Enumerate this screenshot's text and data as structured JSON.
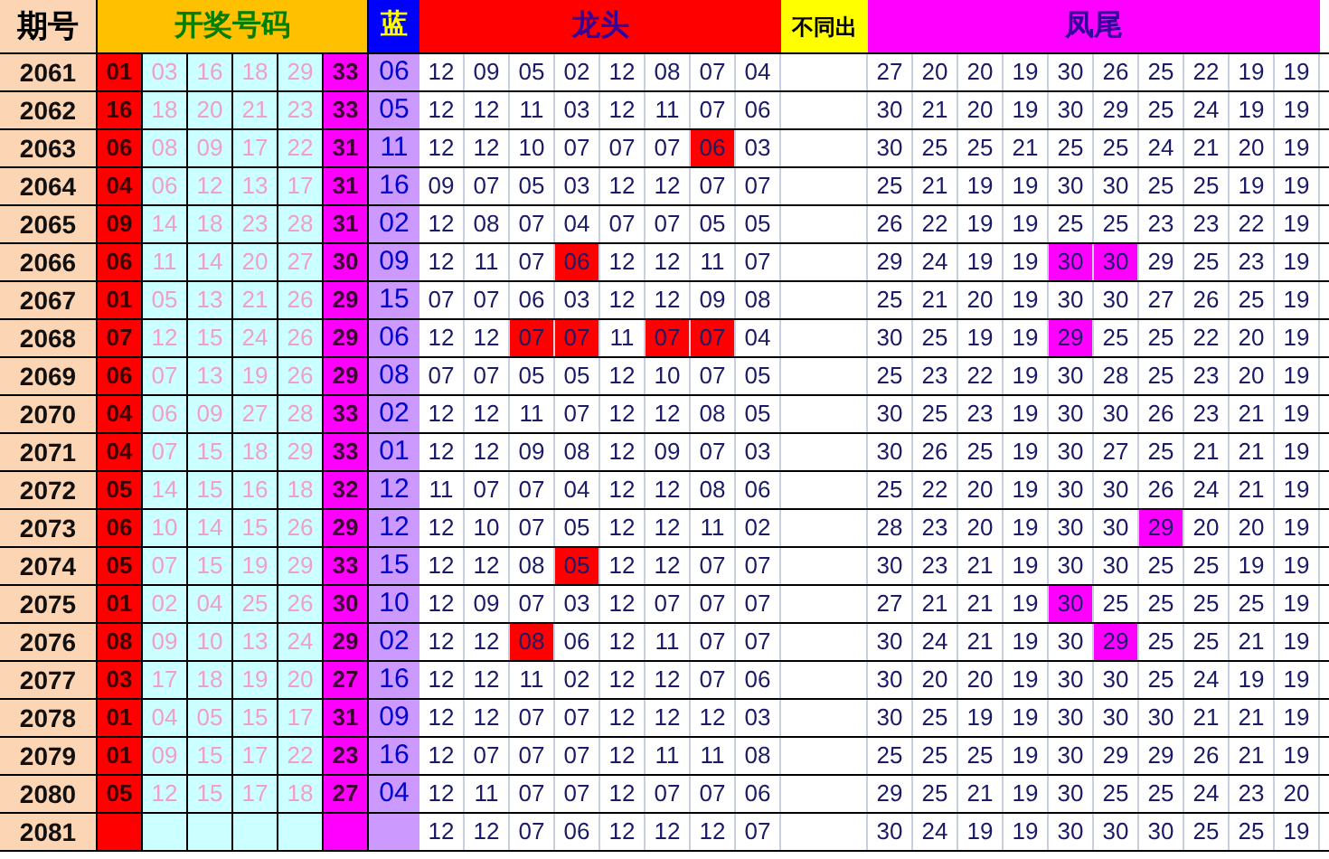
{
  "headers": {
    "period": "期号",
    "draw": "开奖号码",
    "blue": "蓝",
    "dragon": "龙头",
    "distinct": "不同出",
    "phoenix": "凤尾"
  },
  "rows": [
    {
      "period": "2061",
      "balls": [
        "01",
        "03",
        "16",
        "18",
        "29",
        "33"
      ],
      "blue": "06",
      "dragon": [
        {
          "n": "12",
          "hit": false
        },
        {
          "n": "09",
          "hit": false
        },
        {
          "n": "05",
          "hit": false
        },
        {
          "n": "02",
          "hit": false
        },
        {
          "n": "12",
          "hit": false
        },
        {
          "n": "08",
          "hit": false
        },
        {
          "n": "07",
          "hit": false
        },
        {
          "n": "04",
          "hit": false
        }
      ],
      "phoenix": [
        {
          "n": "27",
          "hit": false
        },
        {
          "n": "20",
          "hit": false
        },
        {
          "n": "20",
          "hit": false
        },
        {
          "n": "19",
          "hit": false
        },
        {
          "n": "30",
          "hit": false
        },
        {
          "n": "26",
          "hit": false
        },
        {
          "n": "25",
          "hit": false
        },
        {
          "n": "22",
          "hit": false
        },
        {
          "n": "19",
          "hit": false
        },
        {
          "n": "19",
          "hit": false
        }
      ]
    },
    {
      "period": "2062",
      "balls": [
        "16",
        "18",
        "20",
        "21",
        "23",
        "33"
      ],
      "blue": "05",
      "dragon": [
        {
          "n": "12",
          "hit": false
        },
        {
          "n": "12",
          "hit": false
        },
        {
          "n": "11",
          "hit": false
        },
        {
          "n": "03",
          "hit": false
        },
        {
          "n": "12",
          "hit": false
        },
        {
          "n": "11",
          "hit": false
        },
        {
          "n": "07",
          "hit": false
        },
        {
          "n": "06",
          "hit": false
        }
      ],
      "phoenix": [
        {
          "n": "30",
          "hit": false
        },
        {
          "n": "21",
          "hit": false
        },
        {
          "n": "20",
          "hit": false
        },
        {
          "n": "19",
          "hit": false
        },
        {
          "n": "30",
          "hit": false
        },
        {
          "n": "29",
          "hit": false
        },
        {
          "n": "25",
          "hit": false
        },
        {
          "n": "24",
          "hit": false
        },
        {
          "n": "19",
          "hit": false
        },
        {
          "n": "19",
          "hit": false
        }
      ]
    },
    {
      "period": "2063",
      "balls": [
        "06",
        "08",
        "09",
        "17",
        "22",
        "31"
      ],
      "blue": "11",
      "dragon": [
        {
          "n": "12",
          "hit": false
        },
        {
          "n": "12",
          "hit": false
        },
        {
          "n": "10",
          "hit": false
        },
        {
          "n": "07",
          "hit": false
        },
        {
          "n": "07",
          "hit": false
        },
        {
          "n": "07",
          "hit": false
        },
        {
          "n": "06",
          "hit": true
        },
        {
          "n": "03",
          "hit": false
        }
      ],
      "phoenix": [
        {
          "n": "30",
          "hit": false
        },
        {
          "n": "25",
          "hit": false
        },
        {
          "n": "25",
          "hit": false
        },
        {
          "n": "21",
          "hit": false
        },
        {
          "n": "25",
          "hit": false
        },
        {
          "n": "25",
          "hit": false
        },
        {
          "n": "24",
          "hit": false
        },
        {
          "n": "21",
          "hit": false
        },
        {
          "n": "20",
          "hit": false
        },
        {
          "n": "19",
          "hit": false
        }
      ]
    },
    {
      "period": "2064",
      "balls": [
        "04",
        "06",
        "12",
        "13",
        "17",
        "31"
      ],
      "blue": "16",
      "dragon": [
        {
          "n": "09",
          "hit": false
        },
        {
          "n": "07",
          "hit": false
        },
        {
          "n": "05",
          "hit": false
        },
        {
          "n": "03",
          "hit": false
        },
        {
          "n": "12",
          "hit": false
        },
        {
          "n": "12",
          "hit": false
        },
        {
          "n": "07",
          "hit": false
        },
        {
          "n": "07",
          "hit": false
        }
      ],
      "phoenix": [
        {
          "n": "25",
          "hit": false
        },
        {
          "n": "21",
          "hit": false
        },
        {
          "n": "19",
          "hit": false
        },
        {
          "n": "19",
          "hit": false
        },
        {
          "n": "30",
          "hit": false
        },
        {
          "n": "30",
          "hit": false
        },
        {
          "n": "25",
          "hit": false
        },
        {
          "n": "25",
          "hit": false
        },
        {
          "n": "19",
          "hit": false
        },
        {
          "n": "19",
          "hit": false
        }
      ]
    },
    {
      "period": "2065",
      "balls": [
        "09",
        "14",
        "18",
        "23",
        "28",
        "31"
      ],
      "blue": "02",
      "dragon": [
        {
          "n": "12",
          "hit": false
        },
        {
          "n": "08",
          "hit": false
        },
        {
          "n": "07",
          "hit": false
        },
        {
          "n": "04",
          "hit": false
        },
        {
          "n": "07",
          "hit": false
        },
        {
          "n": "07",
          "hit": false
        },
        {
          "n": "05",
          "hit": false
        },
        {
          "n": "05",
          "hit": false
        }
      ],
      "phoenix": [
        {
          "n": "26",
          "hit": false
        },
        {
          "n": "22",
          "hit": false
        },
        {
          "n": "19",
          "hit": false
        },
        {
          "n": "19",
          "hit": false
        },
        {
          "n": "25",
          "hit": false
        },
        {
          "n": "25",
          "hit": false
        },
        {
          "n": "23",
          "hit": false
        },
        {
          "n": "23",
          "hit": false
        },
        {
          "n": "22",
          "hit": false
        },
        {
          "n": "19",
          "hit": false
        }
      ]
    },
    {
      "period": "2066",
      "balls": [
        "06",
        "11",
        "14",
        "20",
        "27",
        "30"
      ],
      "blue": "09",
      "dragon": [
        {
          "n": "12",
          "hit": false
        },
        {
          "n": "11",
          "hit": false
        },
        {
          "n": "07",
          "hit": false
        },
        {
          "n": "06",
          "hit": true
        },
        {
          "n": "12",
          "hit": false
        },
        {
          "n": "12",
          "hit": false
        },
        {
          "n": "11",
          "hit": false
        },
        {
          "n": "07",
          "hit": false
        }
      ],
      "phoenix": [
        {
          "n": "29",
          "hit": false
        },
        {
          "n": "24",
          "hit": false
        },
        {
          "n": "19",
          "hit": false
        },
        {
          "n": "19",
          "hit": false
        },
        {
          "n": "30",
          "hit": true
        },
        {
          "n": "30",
          "hit": true
        },
        {
          "n": "29",
          "hit": false
        },
        {
          "n": "25",
          "hit": false
        },
        {
          "n": "23",
          "hit": false
        },
        {
          "n": "19",
          "hit": false
        }
      ]
    },
    {
      "period": "2067",
      "balls": [
        "01",
        "05",
        "13",
        "21",
        "26",
        "29"
      ],
      "blue": "15",
      "dragon": [
        {
          "n": "07",
          "hit": false
        },
        {
          "n": "07",
          "hit": false
        },
        {
          "n": "06",
          "hit": false
        },
        {
          "n": "03",
          "hit": false
        },
        {
          "n": "12",
          "hit": false
        },
        {
          "n": "12",
          "hit": false
        },
        {
          "n": "09",
          "hit": false
        },
        {
          "n": "08",
          "hit": false
        }
      ],
      "phoenix": [
        {
          "n": "25",
          "hit": false
        },
        {
          "n": "21",
          "hit": false
        },
        {
          "n": "20",
          "hit": false
        },
        {
          "n": "19",
          "hit": false
        },
        {
          "n": "30",
          "hit": false
        },
        {
          "n": "30",
          "hit": false
        },
        {
          "n": "27",
          "hit": false
        },
        {
          "n": "26",
          "hit": false
        },
        {
          "n": "25",
          "hit": false
        },
        {
          "n": "19",
          "hit": false
        }
      ]
    },
    {
      "period": "2068",
      "balls": [
        "07",
        "12",
        "15",
        "24",
        "26",
        "29"
      ],
      "blue": "06",
      "dragon": [
        {
          "n": "12",
          "hit": false
        },
        {
          "n": "12",
          "hit": false
        },
        {
          "n": "07",
          "hit": true
        },
        {
          "n": "07",
          "hit": true
        },
        {
          "n": "11",
          "hit": false
        },
        {
          "n": "07",
          "hit": true
        },
        {
          "n": "07",
          "hit": true
        },
        {
          "n": "04",
          "hit": false
        }
      ],
      "phoenix": [
        {
          "n": "30",
          "hit": false
        },
        {
          "n": "25",
          "hit": false
        },
        {
          "n": "19",
          "hit": false
        },
        {
          "n": "19",
          "hit": false
        },
        {
          "n": "29",
          "hit": true
        },
        {
          "n": "25",
          "hit": false
        },
        {
          "n": "25",
          "hit": false
        },
        {
          "n": "22",
          "hit": false
        },
        {
          "n": "20",
          "hit": false
        },
        {
          "n": "19",
          "hit": false
        }
      ]
    },
    {
      "period": "2069",
      "balls": [
        "06",
        "07",
        "13",
        "19",
        "26",
        "29"
      ],
      "blue": "08",
      "dragon": [
        {
          "n": "07",
          "hit": false
        },
        {
          "n": "07",
          "hit": false
        },
        {
          "n": "05",
          "hit": false
        },
        {
          "n": "05",
          "hit": false
        },
        {
          "n": "12",
          "hit": false
        },
        {
          "n": "10",
          "hit": false
        },
        {
          "n": "07",
          "hit": false
        },
        {
          "n": "05",
          "hit": false
        }
      ],
      "phoenix": [
        {
          "n": "25",
          "hit": false
        },
        {
          "n": "23",
          "hit": false
        },
        {
          "n": "22",
          "hit": false
        },
        {
          "n": "19",
          "hit": false
        },
        {
          "n": "30",
          "hit": false
        },
        {
          "n": "28",
          "hit": false
        },
        {
          "n": "25",
          "hit": false
        },
        {
          "n": "23",
          "hit": false
        },
        {
          "n": "20",
          "hit": false
        },
        {
          "n": "19",
          "hit": false
        }
      ]
    },
    {
      "period": "2070",
      "balls": [
        "04",
        "06",
        "09",
        "27",
        "28",
        "33"
      ],
      "blue": "02",
      "dragon": [
        {
          "n": "12",
          "hit": false
        },
        {
          "n": "12",
          "hit": false
        },
        {
          "n": "11",
          "hit": false
        },
        {
          "n": "07",
          "hit": false
        },
        {
          "n": "12",
          "hit": false
        },
        {
          "n": "12",
          "hit": false
        },
        {
          "n": "08",
          "hit": false
        },
        {
          "n": "05",
          "hit": false
        }
      ],
      "phoenix": [
        {
          "n": "30",
          "hit": false
        },
        {
          "n": "25",
          "hit": false
        },
        {
          "n": "23",
          "hit": false
        },
        {
          "n": "19",
          "hit": false
        },
        {
          "n": "30",
          "hit": false
        },
        {
          "n": "30",
          "hit": false
        },
        {
          "n": "26",
          "hit": false
        },
        {
          "n": "23",
          "hit": false
        },
        {
          "n": "21",
          "hit": false
        },
        {
          "n": "19",
          "hit": false
        }
      ]
    },
    {
      "period": "2071",
      "balls": [
        "04",
        "07",
        "15",
        "18",
        "29",
        "33"
      ],
      "blue": "01",
      "dragon": [
        {
          "n": "12",
          "hit": false
        },
        {
          "n": "12",
          "hit": false
        },
        {
          "n": "09",
          "hit": false
        },
        {
          "n": "08",
          "hit": false
        },
        {
          "n": "12",
          "hit": false
        },
        {
          "n": "09",
          "hit": false
        },
        {
          "n": "07",
          "hit": false
        },
        {
          "n": "03",
          "hit": false
        }
      ],
      "phoenix": [
        {
          "n": "30",
          "hit": false
        },
        {
          "n": "26",
          "hit": false
        },
        {
          "n": "25",
          "hit": false
        },
        {
          "n": "19",
          "hit": false
        },
        {
          "n": "30",
          "hit": false
        },
        {
          "n": "27",
          "hit": false
        },
        {
          "n": "25",
          "hit": false
        },
        {
          "n": "21",
          "hit": false
        },
        {
          "n": "21",
          "hit": false
        },
        {
          "n": "19",
          "hit": false
        }
      ]
    },
    {
      "period": "2072",
      "balls": [
        "05",
        "14",
        "15",
        "16",
        "18",
        "32"
      ],
      "blue": "12",
      "dragon": [
        {
          "n": "11",
          "hit": false
        },
        {
          "n": "07",
          "hit": false
        },
        {
          "n": "07",
          "hit": false
        },
        {
          "n": "04",
          "hit": false
        },
        {
          "n": "12",
          "hit": false
        },
        {
          "n": "12",
          "hit": false
        },
        {
          "n": "08",
          "hit": false
        },
        {
          "n": "06",
          "hit": false
        }
      ],
      "phoenix": [
        {
          "n": "25",
          "hit": false
        },
        {
          "n": "22",
          "hit": false
        },
        {
          "n": "20",
          "hit": false
        },
        {
          "n": "19",
          "hit": false
        },
        {
          "n": "30",
          "hit": false
        },
        {
          "n": "30",
          "hit": false
        },
        {
          "n": "26",
          "hit": false
        },
        {
          "n": "24",
          "hit": false
        },
        {
          "n": "21",
          "hit": false
        },
        {
          "n": "19",
          "hit": false
        }
      ]
    },
    {
      "period": "2073",
      "balls": [
        "06",
        "10",
        "14",
        "15",
        "26",
        "29"
      ],
      "blue": "12",
      "dragon": [
        {
          "n": "12",
          "hit": false
        },
        {
          "n": "10",
          "hit": false
        },
        {
          "n": "07",
          "hit": false
        },
        {
          "n": "05",
          "hit": false
        },
        {
          "n": "12",
          "hit": false
        },
        {
          "n": "12",
          "hit": false
        },
        {
          "n": "11",
          "hit": false
        },
        {
          "n": "02",
          "hit": false
        }
      ],
      "phoenix": [
        {
          "n": "28",
          "hit": false
        },
        {
          "n": "23",
          "hit": false
        },
        {
          "n": "20",
          "hit": false
        },
        {
          "n": "19",
          "hit": false
        },
        {
          "n": "30",
          "hit": false
        },
        {
          "n": "30",
          "hit": false
        },
        {
          "n": "29",
          "hit": true
        },
        {
          "n": "20",
          "hit": false
        },
        {
          "n": "20",
          "hit": false
        },
        {
          "n": "19",
          "hit": false
        }
      ]
    },
    {
      "period": "2074",
      "balls": [
        "05",
        "07",
        "15",
        "19",
        "29",
        "33"
      ],
      "blue": "15",
      "dragon": [
        {
          "n": "12",
          "hit": false
        },
        {
          "n": "12",
          "hit": false
        },
        {
          "n": "08",
          "hit": false
        },
        {
          "n": "05",
          "hit": true
        },
        {
          "n": "12",
          "hit": false
        },
        {
          "n": "12",
          "hit": false
        },
        {
          "n": "07",
          "hit": false
        },
        {
          "n": "07",
          "hit": false
        }
      ],
      "phoenix": [
        {
          "n": "30",
          "hit": false
        },
        {
          "n": "23",
          "hit": false
        },
        {
          "n": "21",
          "hit": false
        },
        {
          "n": "19",
          "hit": false
        },
        {
          "n": "30",
          "hit": false
        },
        {
          "n": "30",
          "hit": false
        },
        {
          "n": "25",
          "hit": false
        },
        {
          "n": "25",
          "hit": false
        },
        {
          "n": "19",
          "hit": false
        },
        {
          "n": "19",
          "hit": false
        }
      ]
    },
    {
      "period": "2075",
      "balls": [
        "01",
        "02",
        "04",
        "25",
        "26",
        "30"
      ],
      "blue": "10",
      "dragon": [
        {
          "n": "12",
          "hit": false
        },
        {
          "n": "09",
          "hit": false
        },
        {
          "n": "07",
          "hit": false
        },
        {
          "n": "03",
          "hit": false
        },
        {
          "n": "12",
          "hit": false
        },
        {
          "n": "07",
          "hit": false
        },
        {
          "n": "07",
          "hit": false
        },
        {
          "n": "07",
          "hit": false
        }
      ],
      "phoenix": [
        {
          "n": "27",
          "hit": false
        },
        {
          "n": "21",
          "hit": false
        },
        {
          "n": "21",
          "hit": false
        },
        {
          "n": "19",
          "hit": false
        },
        {
          "n": "30",
          "hit": true
        },
        {
          "n": "25",
          "hit": false
        },
        {
          "n": "25",
          "hit": false
        },
        {
          "n": "25",
          "hit": false
        },
        {
          "n": "25",
          "hit": false
        },
        {
          "n": "19",
          "hit": false
        }
      ]
    },
    {
      "period": "2076",
      "balls": [
        "08",
        "09",
        "10",
        "13",
        "24",
        "29"
      ],
      "blue": "02",
      "dragon": [
        {
          "n": "12",
          "hit": false
        },
        {
          "n": "12",
          "hit": false
        },
        {
          "n": "08",
          "hit": true
        },
        {
          "n": "06",
          "hit": false
        },
        {
          "n": "12",
          "hit": false
        },
        {
          "n": "11",
          "hit": false
        },
        {
          "n": "07",
          "hit": false
        },
        {
          "n": "07",
          "hit": false
        }
      ],
      "phoenix": [
        {
          "n": "30",
          "hit": false
        },
        {
          "n": "24",
          "hit": false
        },
        {
          "n": "21",
          "hit": false
        },
        {
          "n": "19",
          "hit": false
        },
        {
          "n": "30",
          "hit": false
        },
        {
          "n": "29",
          "hit": true
        },
        {
          "n": "25",
          "hit": false
        },
        {
          "n": "25",
          "hit": false
        },
        {
          "n": "21",
          "hit": false
        },
        {
          "n": "19",
          "hit": false
        }
      ]
    },
    {
      "period": "2077",
      "balls": [
        "03",
        "17",
        "18",
        "19",
        "20",
        "27"
      ],
      "blue": "16",
      "dragon": [
        {
          "n": "12",
          "hit": false
        },
        {
          "n": "12",
          "hit": false
        },
        {
          "n": "11",
          "hit": false
        },
        {
          "n": "02",
          "hit": false
        },
        {
          "n": "12",
          "hit": false
        },
        {
          "n": "12",
          "hit": false
        },
        {
          "n": "07",
          "hit": false
        },
        {
          "n": "06",
          "hit": false
        }
      ],
      "phoenix": [
        {
          "n": "30",
          "hit": false
        },
        {
          "n": "20",
          "hit": false
        },
        {
          "n": "20",
          "hit": false
        },
        {
          "n": "19",
          "hit": false
        },
        {
          "n": "30",
          "hit": false
        },
        {
          "n": "30",
          "hit": false
        },
        {
          "n": "25",
          "hit": false
        },
        {
          "n": "24",
          "hit": false
        },
        {
          "n": "19",
          "hit": false
        },
        {
          "n": "19",
          "hit": false
        }
      ]
    },
    {
      "period": "2078",
      "balls": [
        "01",
        "04",
        "05",
        "15",
        "17",
        "31"
      ],
      "blue": "09",
      "dragon": [
        {
          "n": "12",
          "hit": false
        },
        {
          "n": "12",
          "hit": false
        },
        {
          "n": "07",
          "hit": false
        },
        {
          "n": "07",
          "hit": false
        },
        {
          "n": "12",
          "hit": false
        },
        {
          "n": "12",
          "hit": false
        },
        {
          "n": "12",
          "hit": false
        },
        {
          "n": "03",
          "hit": false
        }
      ],
      "phoenix": [
        {
          "n": "30",
          "hit": false
        },
        {
          "n": "25",
          "hit": false
        },
        {
          "n": "19",
          "hit": false
        },
        {
          "n": "19",
          "hit": false
        },
        {
          "n": "30",
          "hit": false
        },
        {
          "n": "30",
          "hit": false
        },
        {
          "n": "30",
          "hit": false
        },
        {
          "n": "21",
          "hit": false
        },
        {
          "n": "21",
          "hit": false
        },
        {
          "n": "19",
          "hit": false
        }
      ]
    },
    {
      "period": "2079",
      "balls": [
        "01",
        "09",
        "15",
        "17",
        "22",
        "23"
      ],
      "blue": "16",
      "dragon": [
        {
          "n": "12",
          "hit": false
        },
        {
          "n": "07",
          "hit": false
        },
        {
          "n": "07",
          "hit": false
        },
        {
          "n": "07",
          "hit": false
        },
        {
          "n": "12",
          "hit": false
        },
        {
          "n": "11",
          "hit": false
        },
        {
          "n": "11",
          "hit": false
        },
        {
          "n": "08",
          "hit": false
        }
      ],
      "phoenix": [
        {
          "n": "25",
          "hit": false
        },
        {
          "n": "25",
          "hit": false
        },
        {
          "n": "25",
          "hit": false
        },
        {
          "n": "19",
          "hit": false
        },
        {
          "n": "30",
          "hit": false
        },
        {
          "n": "29",
          "hit": false
        },
        {
          "n": "29",
          "hit": false
        },
        {
          "n": "26",
          "hit": false
        },
        {
          "n": "21",
          "hit": false
        },
        {
          "n": "19",
          "hit": false
        }
      ]
    },
    {
      "period": "2080",
      "balls": [
        "05",
        "12",
        "15",
        "17",
        "18",
        "27"
      ],
      "blue": "04",
      "dragon": [
        {
          "n": "12",
          "hit": false
        },
        {
          "n": "11",
          "hit": false
        },
        {
          "n": "07",
          "hit": false
        },
        {
          "n": "07",
          "hit": false
        },
        {
          "n": "12",
          "hit": false
        },
        {
          "n": "07",
          "hit": false
        },
        {
          "n": "07",
          "hit": false
        },
        {
          "n": "06",
          "hit": false
        }
      ],
      "phoenix": [
        {
          "n": "29",
          "hit": false
        },
        {
          "n": "25",
          "hit": false
        },
        {
          "n": "21",
          "hit": false
        },
        {
          "n": "19",
          "hit": false
        },
        {
          "n": "30",
          "hit": false
        },
        {
          "n": "25",
          "hit": false
        },
        {
          "n": "25",
          "hit": false
        },
        {
          "n": "24",
          "hit": false
        },
        {
          "n": "23",
          "hit": false
        },
        {
          "n": "20",
          "hit": false
        }
      ]
    },
    {
      "period": "2081",
      "dragon": [
        {
          "n": "12",
          "hit": false
        },
        {
          "n": "12",
          "hit": false
        },
        {
          "n": "07",
          "hit": false
        },
        {
          "n": "06",
          "hit": false
        },
        {
          "n": "12",
          "hit": false
        },
        {
          "n": "12",
          "hit": false
        },
        {
          "n": "12",
          "hit": false
        },
        {
          "n": "07",
          "hit": false
        }
      ],
      "phoenix": [
        {
          "n": "30",
          "hit": false
        },
        {
          "n": "24",
          "hit": false
        },
        {
          "n": "19",
          "hit": false
        },
        {
          "n": "19",
          "hit": false
        },
        {
          "n": "30",
          "hit": false
        },
        {
          "n": "30",
          "hit": false
        },
        {
          "n": "30",
          "hit": false
        },
        {
          "n": "25",
          "hit": false
        },
        {
          "n": "25",
          "hit": false
        },
        {
          "n": "19",
          "hit": false
        }
      ]
    }
  ]
}
